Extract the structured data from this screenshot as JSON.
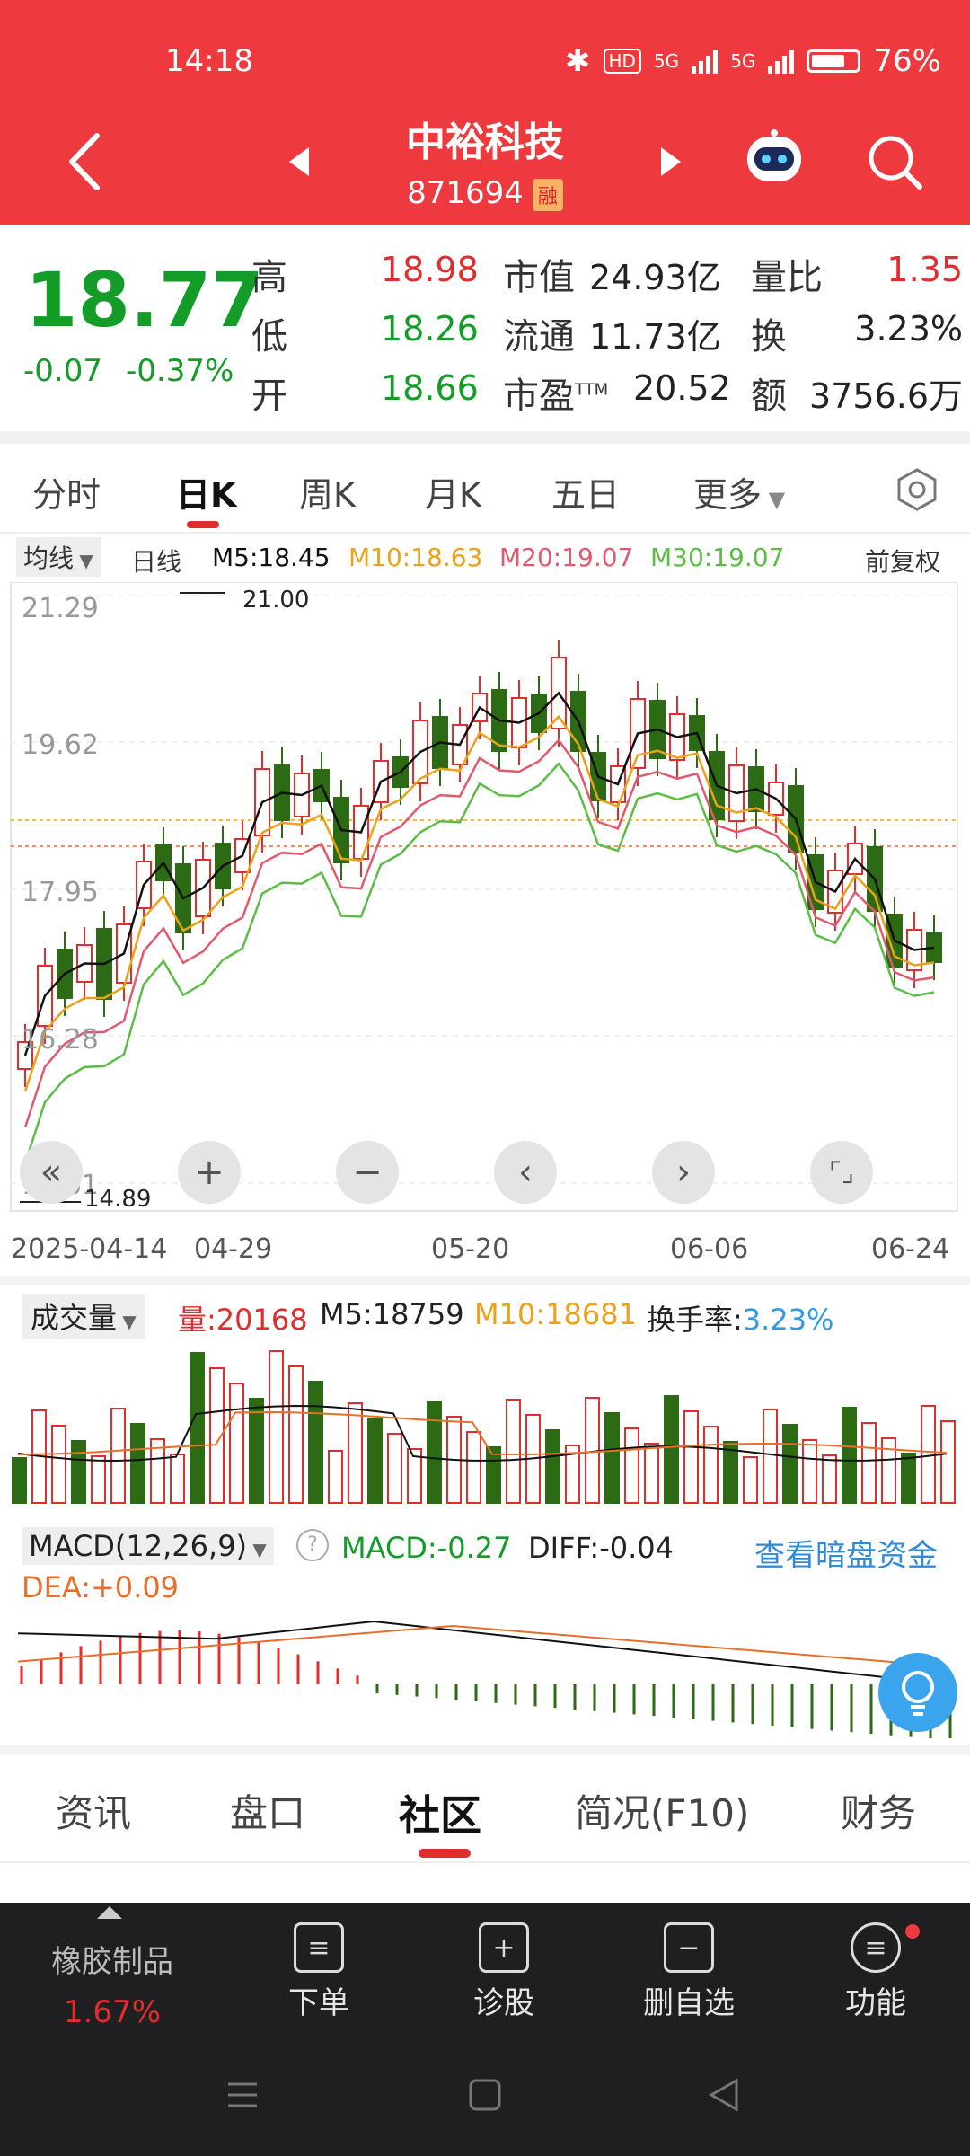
{
  "status": {
    "time": "14:18",
    "hd": "HD",
    "net1": "5G",
    "net2": "5G",
    "battery": "76%"
  },
  "stock": {
    "name": "中裕科技",
    "code": "871694",
    "tag": "融"
  },
  "quote": {
    "price": "18.77",
    "change": "-0.07",
    "change_pct": "-0.37%",
    "high_label": "高",
    "high": "18.98",
    "low_label": "低",
    "low": "18.26",
    "open_label": "开",
    "open": "18.66",
    "mcap_label": "市值",
    "mcap": "24.93亿",
    "float_label": "流通",
    "float": "11.73亿",
    "pe_label": "市盈",
    "pe_sup": "TTM",
    "pe": "20.52",
    "vr_label": "量比",
    "vr": "1.35",
    "turn_label": "换",
    "turn": "3.23%",
    "amt_label": "额",
    "amt": "3756.6万"
  },
  "period_tabs": [
    "分时",
    "日K",
    "周K",
    "月K",
    "五日",
    "更多"
  ],
  "legend": {
    "ma_label": "均线",
    "type": "日线",
    "m5": "M5:18.45",
    "m10": "M10:18.63",
    "m20": "M20:19.07",
    "m30": "M30:19.07",
    "adjust": "前复权"
  },
  "kline": {
    "ylabels": [
      "21.29",
      "19.62",
      "17.95",
      "16.28",
      "14.61"
    ],
    "high_mark": "21.00",
    "low_mark": "14.89",
    "dates": [
      "2025-04-14",
      "04-29",
      "05-20",
      "06-06",
      "06-24"
    ],
    "colors": {
      "up": "#e02d2d",
      "down": "#2d6a14",
      "m5": "#111111",
      "m10": "#e9a21a",
      "m20": "#e05a6e",
      "m30": "#5cbd46"
    }
  },
  "volume": {
    "label": "成交量",
    "vol": "量:20168",
    "m5": "M5:18759",
    "m10": "M10:18681",
    "turn_label": "换手率:",
    "turn": "3.23%"
  },
  "macd": {
    "label": "MACD(12,26,9)",
    "macd": "MACD:-0.27",
    "diff": "DIFF:-0.04",
    "dea": "DEA:+0.09",
    "link": "查看暗盘资金"
  },
  "bottom_tabs": [
    "资讯",
    "盘口",
    "社区",
    "简况(F10)",
    "财务"
  ],
  "bottom_bar": {
    "sector": "橡胶制品",
    "sector_pct": "1.67%",
    "order": "下单",
    "diagnose": "诊股",
    "remove": "删自选",
    "func": "功能"
  }
}
